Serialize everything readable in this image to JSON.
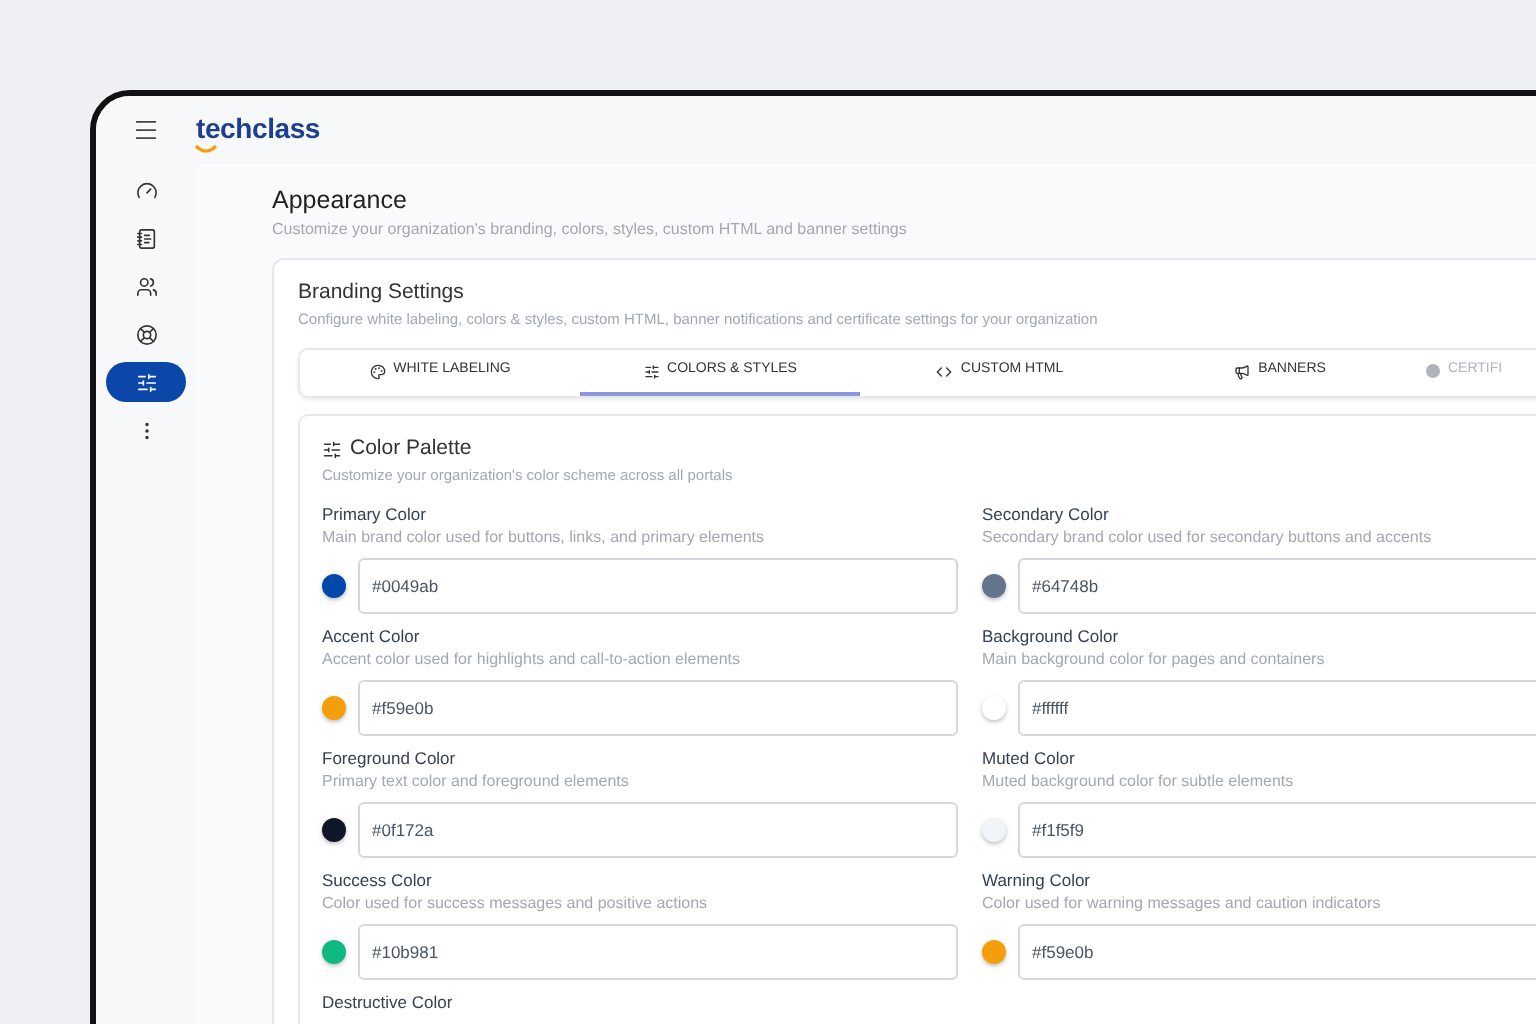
{
  "header": {
    "logo": "techclass"
  },
  "sidebar": {
    "items": [
      {
        "kind": "gauge",
        "selected": false
      },
      {
        "kind": "book",
        "selected": false
      },
      {
        "kind": "users",
        "selected": false
      },
      {
        "kind": "support",
        "selected": false
      },
      {
        "kind": "sliders",
        "selected": true
      },
      {
        "kind": "more",
        "selected": false
      }
    ]
  },
  "page": {
    "title": "Appearance",
    "subtitle": "Customize your organization's branding, colors, styles, custom HTML and banner settings"
  },
  "card": {
    "title": "Branding Settings",
    "subtitle": "Configure white labeling, colors & styles, custom HTML, banner notifications and certificate settings for your organization"
  },
  "tabs": [
    {
      "label": "WHITE LABELING",
      "kind": "palette",
      "selected": false,
      "disabled": false
    },
    {
      "label": "COLORS & STYLES",
      "kind": "sliders",
      "selected": true,
      "disabled": false
    },
    {
      "label": "CUSTOM HTML",
      "kind": "code",
      "selected": false,
      "disabled": false
    },
    {
      "label": "BANNERS",
      "kind": "megaphone",
      "selected": false,
      "disabled": false
    },
    {
      "label": "CERTIFI",
      "kind": "dot",
      "selected": false,
      "disabled": true
    }
  ],
  "palette": {
    "title": "Color Palette",
    "subtitle": "Customize your organization's color scheme across all portals",
    "fields": [
      {
        "label": "Primary Color",
        "description": "Main brand color used for buttons, links, and primary elements",
        "value": "#0049ab",
        "color": "#0049ab"
      },
      {
        "label": "Secondary Color",
        "description": "Secondary brand color used for secondary buttons and accents",
        "value": "#64748b",
        "color": "#64748b"
      },
      {
        "label": "Accent Color",
        "description": "Accent color used for highlights and call-to-action elements",
        "value": "#f59e0b",
        "color": "#f59e0b"
      },
      {
        "label": "Background Color",
        "description": "Main background color for pages and containers",
        "value": "#ffffff",
        "color": "#ffffff"
      },
      {
        "label": "Foreground Color",
        "description": "Primary text color and foreground elements",
        "value": "#0f172a",
        "color": "#0f172a"
      },
      {
        "label": "Muted Color",
        "description": "Muted background color for subtle elements",
        "value": "#f1f5f9",
        "color": "#f1f5f9"
      },
      {
        "label": "Success Color",
        "description": "Color used for success messages and positive actions",
        "value": "#10b981",
        "color": "#10b981"
      },
      {
        "label": "Warning Color",
        "description": "Color used for warning messages and caution indicators",
        "value": "#f59e0b",
        "color": "#f59e0b"
      },
      {
        "label": "Destructive Color"
      }
    ]
  }
}
